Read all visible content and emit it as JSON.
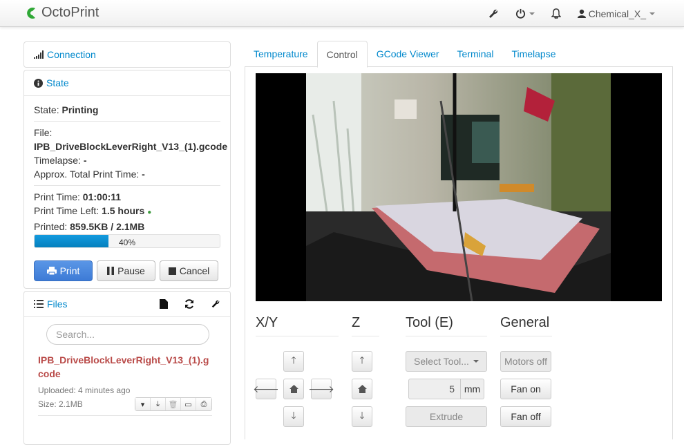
{
  "navbar": {
    "brand": "OctoPrint",
    "user": "Chemical_X_",
    "icons": [
      "wrench-icon",
      "power-icon",
      "bell-icon",
      "user-icon"
    ]
  },
  "sidebar": {
    "connection": {
      "label": "Connection"
    },
    "state": {
      "label": "State",
      "state_label": "State:",
      "state_value": "Printing",
      "file_label": "File:",
      "file_value": "IPB_DriveBlockLeverRight_V13_(1).gcode",
      "timelapse_label": "Timelapse:",
      "timelapse_value": "-",
      "approx_label": "Approx. Total Print Time:",
      "approx_value": "-",
      "print_time_label": "Print Time:",
      "print_time_value": "01:00:11",
      "time_left_label": "Print Time Left:",
      "time_left_value": "1.5 hours",
      "printed_label": "Printed:",
      "printed_value": "859.5KB / 2.1MB",
      "progress_text": "40%",
      "progress_fraction": 0.4,
      "print_button": "Print",
      "pause_button": "Pause",
      "cancel_button": "Cancel"
    },
    "files": {
      "label": "Files",
      "search_placeholder": "Search...",
      "file_name": "IPB_DriveBlockLeverRight_V13_(1).gcode",
      "uploaded": "Uploaded: 4 minutes ago",
      "size": "Size: 2.1MB"
    }
  },
  "tabs": [
    "Temperature",
    "Control",
    "GCode Viewer",
    "Terminal",
    "Timelapse"
  ],
  "active_tab": "Control",
  "control": {
    "xy_title": "X/Y",
    "z_title": "Z",
    "tool_title": "Tool (E)",
    "general_title": "General",
    "select_tool": "Select Tool...",
    "extrude_amount": "5",
    "extrude_unit": "mm",
    "extrude_button": "Extrude",
    "motors_off": "Motors off",
    "fan_on": "Fan on",
    "fan_off": "Fan off"
  },
  "colors": {
    "link": "#0088cc",
    "primary_button": "#4a88dd",
    "progress": "#0e90d2",
    "file_name": "#b94a48",
    "logo": "#2fa836"
  }
}
